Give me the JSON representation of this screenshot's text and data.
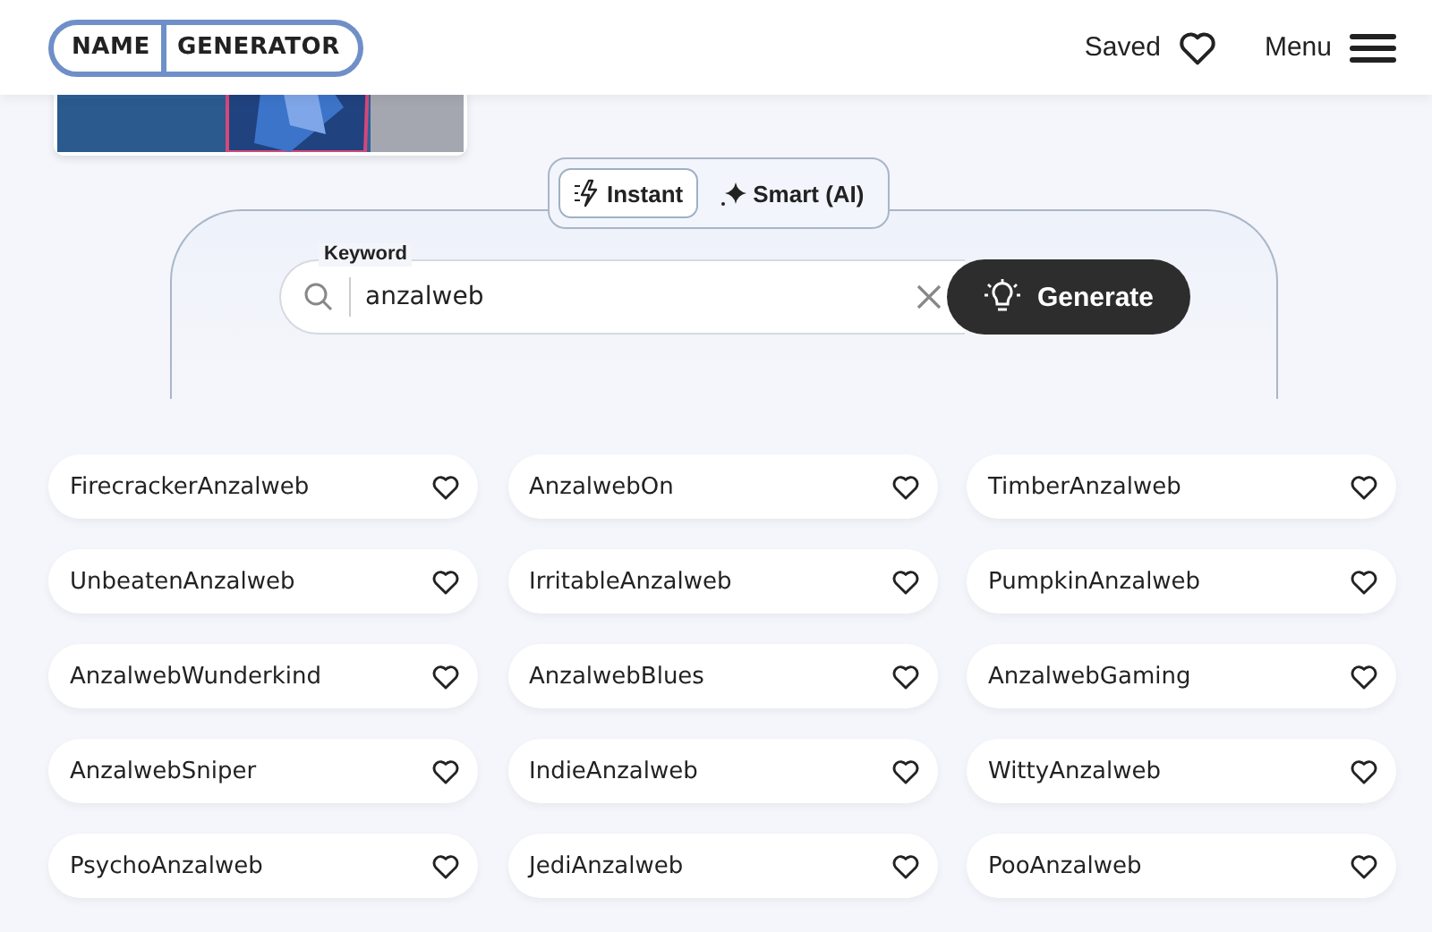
{
  "header": {
    "logo": [
      "NAME",
      "GENERATOR"
    ],
    "saved": "Saved",
    "menu": "Menu"
  },
  "modes": [
    {
      "label": "Instant",
      "kind": "instant",
      "selected": true
    },
    {
      "label": "Smart (AI)",
      "kind": "smart",
      "selected": false
    }
  ],
  "search": {
    "label": "Keyword",
    "value": "anzalweb",
    "button": "Generate"
  },
  "results": [
    {
      "name": "FirecrackerAnzalweb",
      "saved": false
    },
    {
      "name": "AnzalwebOn",
      "saved": false
    },
    {
      "name": "TimberAnzalweb",
      "saved": false
    },
    {
      "name": "UnbeatenAnzalweb",
      "saved": false
    },
    {
      "name": "IrritableAnzalweb",
      "saved": false
    },
    {
      "name": "PumpkinAnzalweb",
      "saved": false
    },
    {
      "name": "AnzalwebWunderkind",
      "saved": false
    },
    {
      "name": "AnzalwebBlues",
      "saved": false
    },
    {
      "name": "AnzalwebGaming",
      "saved": false
    },
    {
      "name": "AnzalwebSniper",
      "saved": false
    },
    {
      "name": "IndieAnzalweb",
      "saved": false
    },
    {
      "name": "WittyAnzalweb",
      "saved": false
    },
    {
      "name": "PsychoAnzalweb",
      "saved": false
    },
    {
      "name": "JediAnzalweb",
      "saved": false
    },
    {
      "name": "PooAnzalweb",
      "saved": false
    }
  ]
}
